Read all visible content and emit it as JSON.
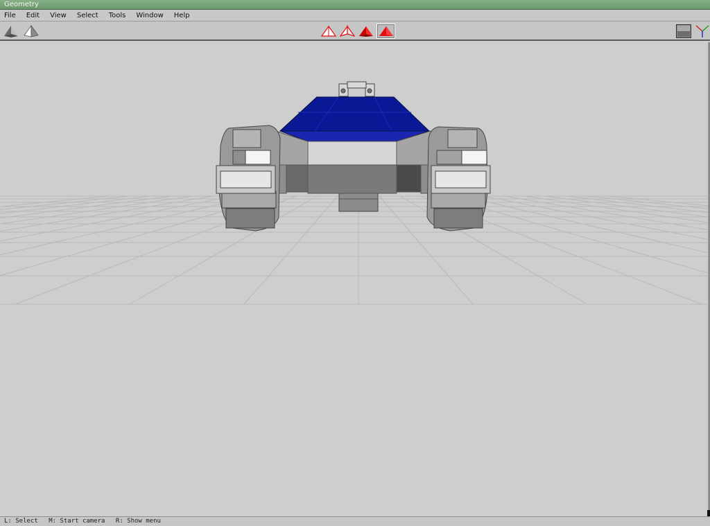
{
  "window": {
    "title": "Geometry"
  },
  "menu": {
    "items": [
      "File",
      "Edit",
      "View",
      "Select",
      "Tools",
      "Window",
      "Help"
    ]
  },
  "toolbar": {
    "left_icons": [
      "smooth-cone-shade-icon",
      "flat-cone-shade-icon"
    ],
    "center_icons": [
      "wireframe-cone-icon",
      "hidden-line-cone-icon",
      "shaded-cone-icon",
      "shaded-cone-selected-icon"
    ],
    "right_icons": [
      "grid-toggle-icon",
      "axis-gizmo-icon"
    ],
    "active_center_index": 3
  },
  "colors": {
    "accent_red": "#e01010",
    "body_blue": "#0a1896",
    "titlebar_green": "#78a478"
  },
  "status": {
    "left": "L: Select",
    "middle": "M: Start camera",
    "right": "R: Show menu"
  }
}
